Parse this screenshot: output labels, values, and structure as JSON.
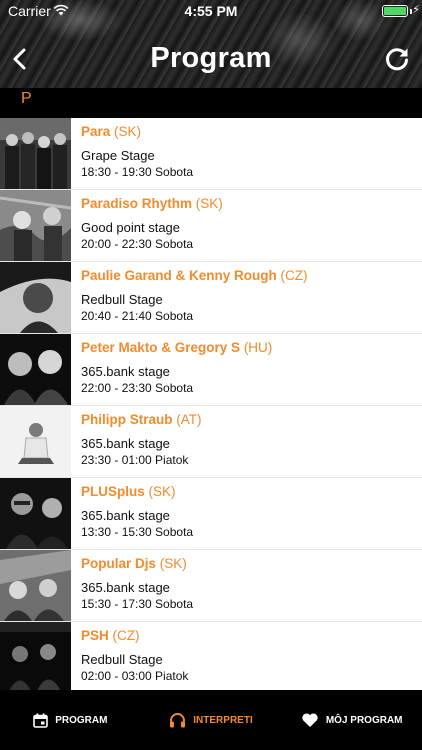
{
  "status_bar": {
    "carrier": "Carrier",
    "time": "4:55 PM",
    "battery_level": 1.0,
    "battery_color": "#4cd964"
  },
  "header": {
    "title": "Program",
    "back_icon": "chevron-left-icon",
    "refresh_icon": "refresh-icon"
  },
  "section": {
    "letter": "P"
  },
  "accent_color": "#f28b2c",
  "rows": [
    {
      "name": "Para",
      "country": "(SK)",
      "stage": "Grape Stage",
      "time": "18:30 - 19:30 Sobota"
    },
    {
      "name": "Paradiso Rhythm",
      "country": "(SK)",
      "stage": "Good point stage",
      "time": "20:00 - 22:30 Sobota"
    },
    {
      "name": "Paulie Garand & Kenny Rough",
      "country": "(CZ)",
      "stage": "Redbull Stage",
      "time": "20:40 - 21:40 Sobota"
    },
    {
      "name": "Peter Makto & Gregory S",
      "country": "(HU)",
      "stage": "365.bank stage",
      "time": "22:00 - 23:30 Sobota"
    },
    {
      "name": "Philipp Straub",
      "country": "(AT)",
      "stage": "365.bank stage",
      "time": "23:30 - 01:00 Piatok"
    },
    {
      "name": "PLUSplus",
      "country": "(SK)",
      "stage": "365.bank stage",
      "time": "13:30 - 15:30 Sobota"
    },
    {
      "name": "Popular Djs",
      "country": "(SK)",
      "stage": "365.bank stage",
      "time": "15:30 - 17:30 Sobota"
    },
    {
      "name": "PSH",
      "country": "(CZ)",
      "stage": "Redbull Stage",
      "time": "02:00 - 03:00 Piatok"
    }
  ],
  "tabs": [
    {
      "label": "PROGRAM",
      "icon": "calendar-icon",
      "active": false
    },
    {
      "label": "INTERPRETI",
      "icon": "headphones-icon",
      "active": true
    },
    {
      "label": "MÔJ PROGRAM",
      "icon": "heart-icon",
      "active": false
    }
  ]
}
